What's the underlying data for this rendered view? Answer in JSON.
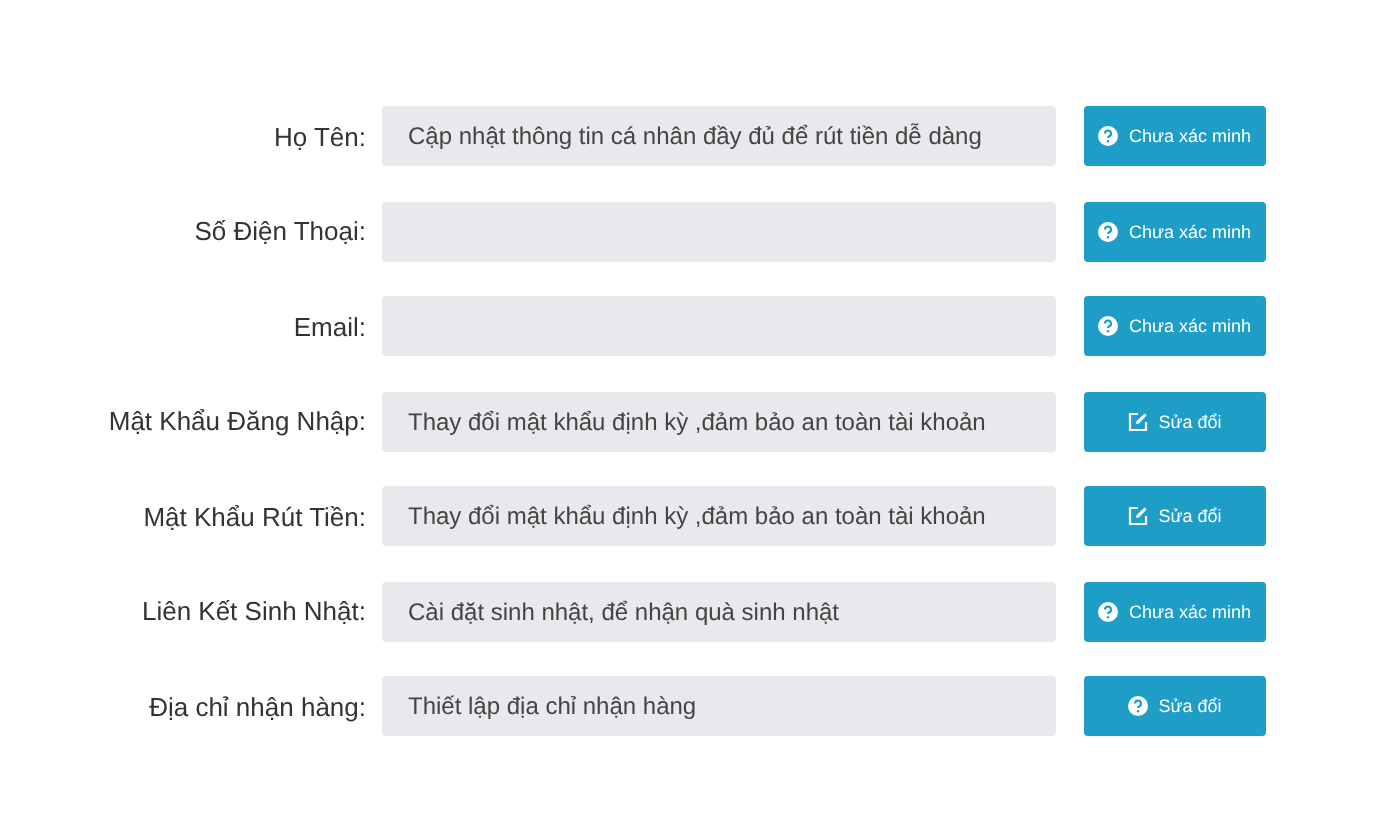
{
  "rows": [
    {
      "label": "Họ Tên:",
      "placeholder": "Cập nhật thông tin cá nhân đầy đủ để rút tiền dễ dàng",
      "button": {
        "kind": "question",
        "label": "Chưa xác minh"
      }
    },
    {
      "label": "Số Điện Thoại:",
      "button": {
        "kind": "question",
        "label": "Chưa xác minh"
      }
    },
    {
      "label": "Email:",
      "button": {
        "kind": "question",
        "label": "Chưa xác minh"
      }
    },
    {
      "label": "Mật Khẩu Đăng Nhập:",
      "placeholder": "Thay đổi mật khẩu định kỳ ,đảm bảo an toàn tài khoản",
      "button": {
        "kind": "edit",
        "label": "Sửa đổi"
      }
    },
    {
      "label": "Mật Khẩu Rút Tiền:",
      "placeholder": "Thay đổi mật khẩu định kỳ ,đảm bảo an toàn tài khoản",
      "button": {
        "kind": "edit",
        "label": "Sửa đổi"
      }
    },
    {
      "label": "Liên Kết Sinh Nhật:",
      "placeholder": "Cài đặt sinh nhật, để nhận quà sinh nhật",
      "button": {
        "kind": "question",
        "label": "Chưa xác minh"
      }
    },
    {
      "label": "Địa chỉ nhận hàng:",
      "placeholder": "Thiết lập địa chỉ nhận hàng",
      "button": {
        "kind": "question",
        "label": "Sửa đổi"
      }
    }
  ]
}
